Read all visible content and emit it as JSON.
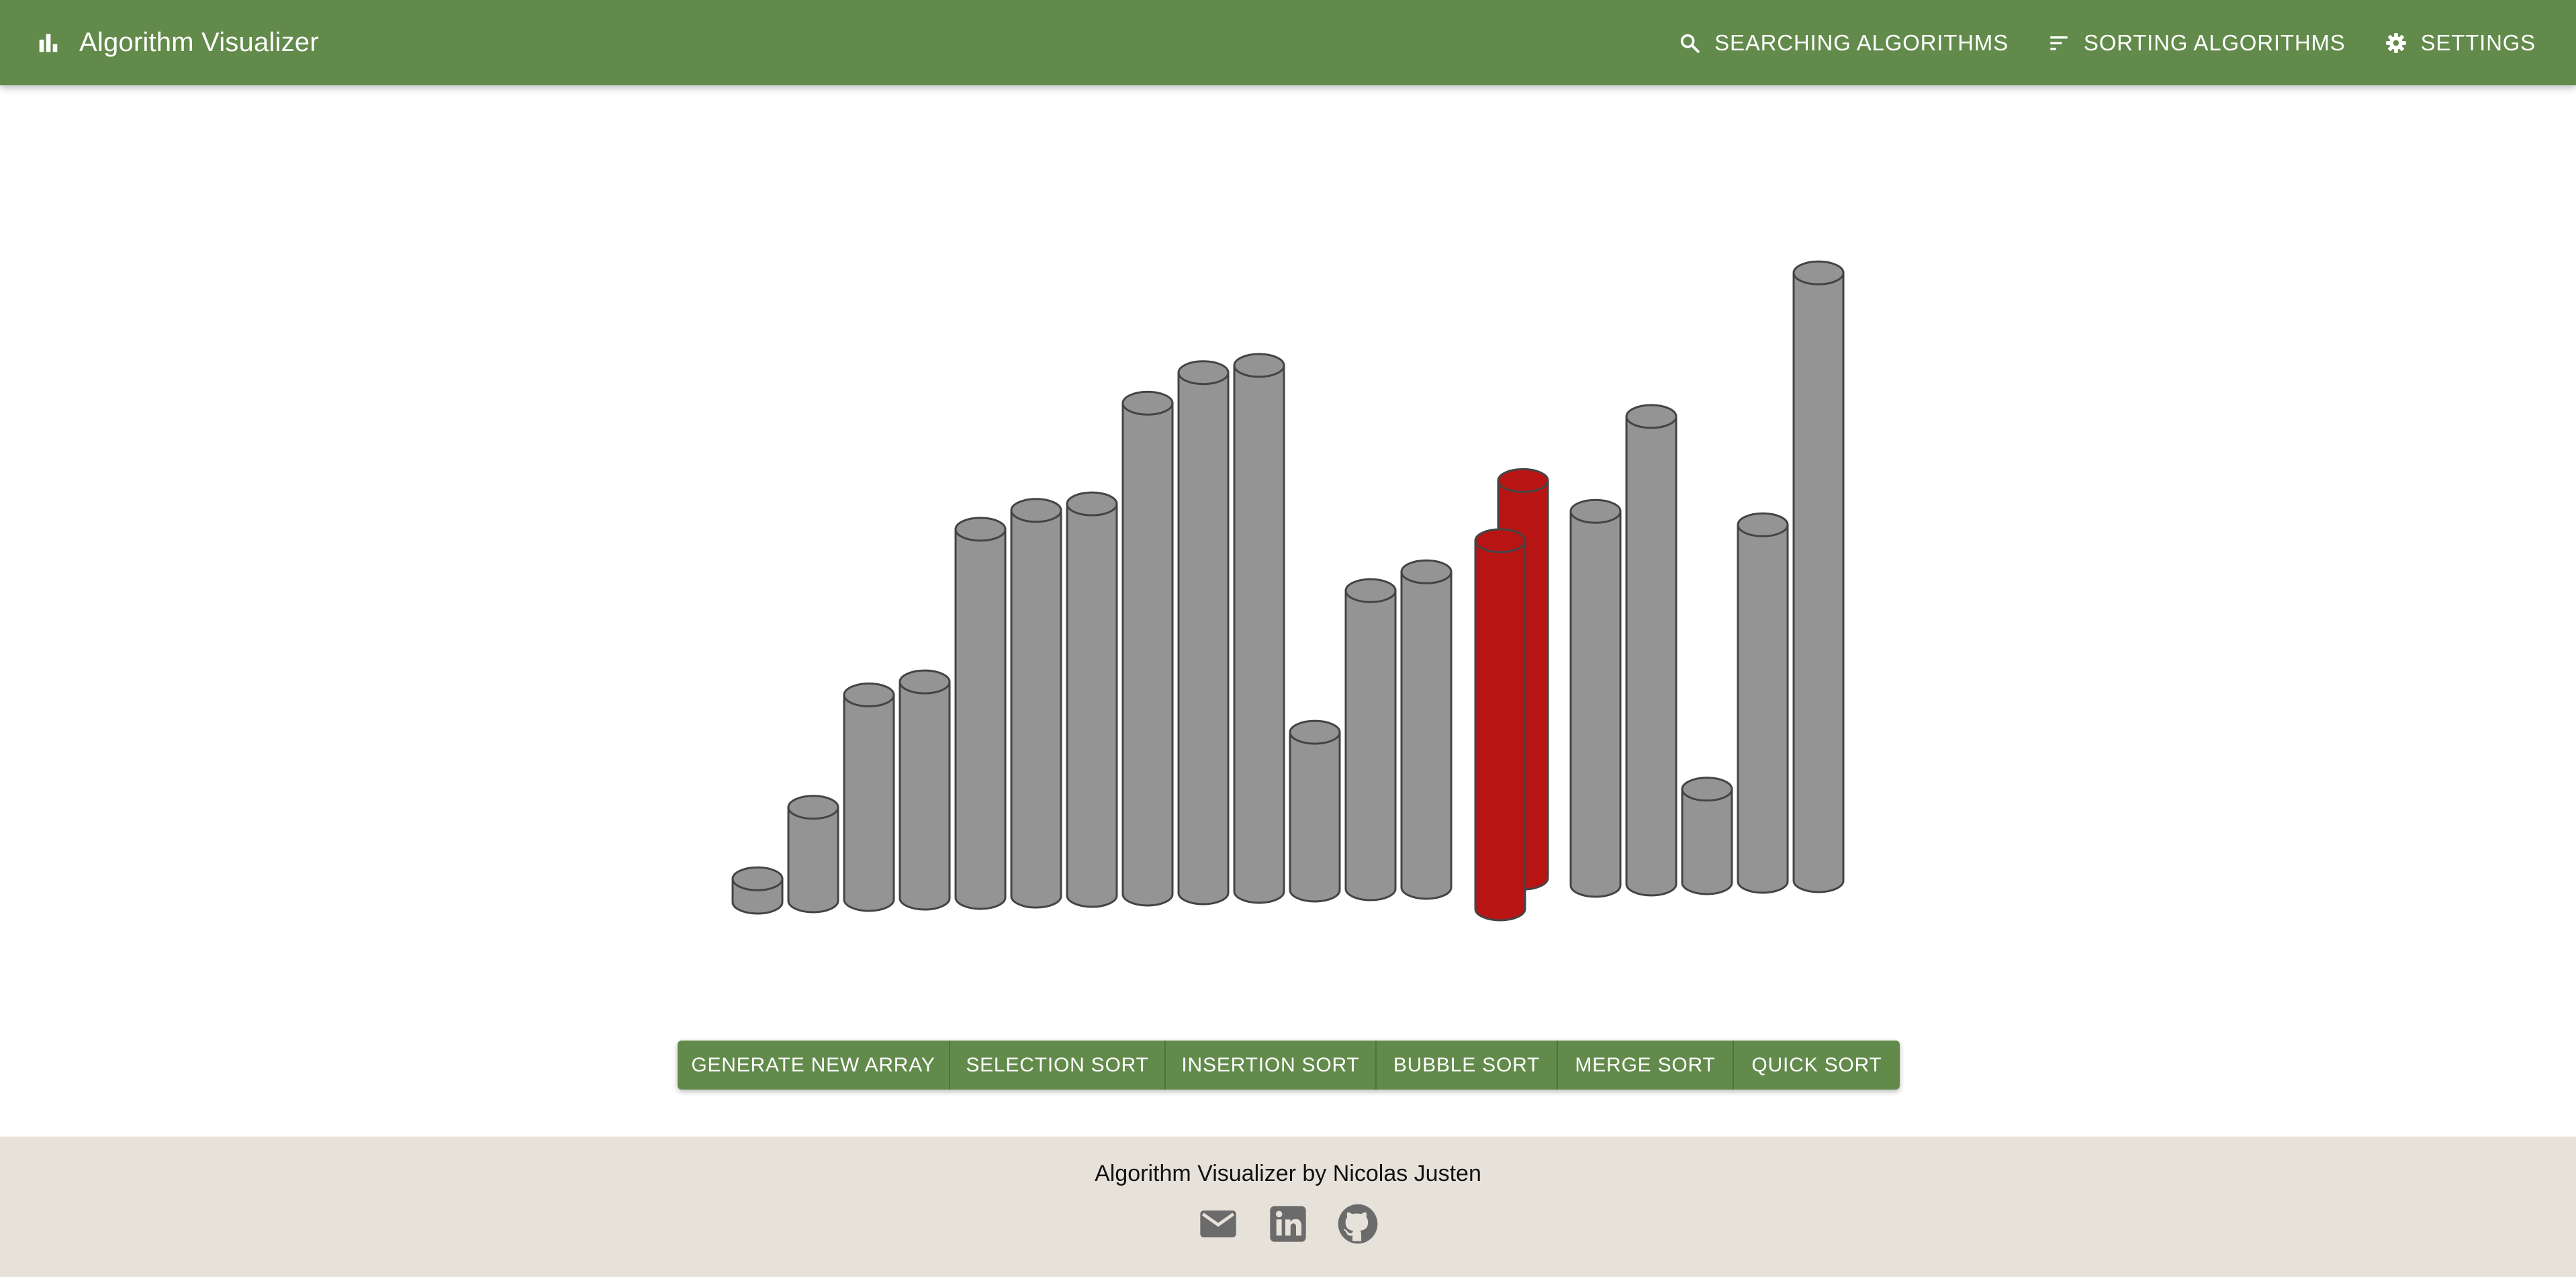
{
  "app": {
    "title": "Algorithm Visualizer",
    "logo_icon": "bar-chart-icon"
  },
  "nav": [
    {
      "label": "SEARCHING ALGORITHMS",
      "icon": "search-icon"
    },
    {
      "label": "SORTING ALGORITHMS",
      "icon": "sort-icon"
    },
    {
      "label": "SETTINGS",
      "icon": "gear-icon"
    }
  ],
  "colors": {
    "primary": "#628a4b",
    "bar": "#949494",
    "bar_outline": "#444444",
    "highlight": "#b81414",
    "footer_bg": "#e6e2da"
  },
  "chart_data": {
    "type": "bar",
    "values": [
      4,
      16,
      35,
      37,
      63,
      66,
      67,
      84,
      89,
      90,
      27,
      51,
      54,
      63,
      68,
      64,
      80,
      16,
      61,
      104
    ],
    "highlighted_indices": [
      13,
      14
    ]
  },
  "toolbar": {
    "buttons": [
      "GENERATE NEW ARRAY",
      "SELECTION SORT",
      "INSERTION SORT",
      "BUBBLE SORT",
      "MERGE SORT",
      "QUICK SORT"
    ]
  },
  "footer": {
    "text": "Algorithm Visualizer by Nicolas Justen",
    "icons": [
      "mail-icon",
      "linkedin-icon",
      "github-icon"
    ]
  }
}
